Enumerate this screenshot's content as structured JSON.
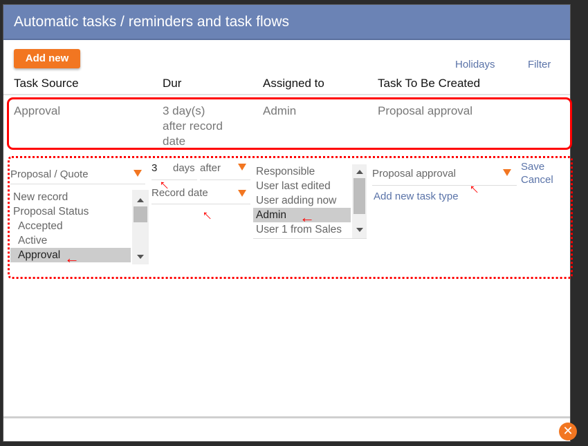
{
  "dialog": {
    "title": "Automatic tasks / reminders and task flows",
    "add_new_label": "Add new",
    "holidays_label": "Holidays",
    "filter_label": "Filter"
  },
  "table": {
    "headers": [
      "Task Source",
      "Dur",
      "Assigned to",
      "Task To Be Created"
    ],
    "rows": [
      {
        "task_source": "Approval",
        "duration_lines": [
          "3 day(s)",
          "after record",
          "date"
        ],
        "assigned_to": "Admin",
        "task_to_be_created": "Proposal approval"
      }
    ]
  },
  "editor": {
    "source_type_select": "Proposal / Quote",
    "source_list": [
      {
        "label": "New record",
        "indent": false,
        "selected": false
      },
      {
        "label": "Proposal Status",
        "indent": false,
        "selected": false
      },
      {
        "label": "Accepted",
        "indent": true,
        "selected": false
      },
      {
        "label": "Active",
        "indent": true,
        "selected": false
      },
      {
        "label": "Approval",
        "indent": true,
        "selected": true
      }
    ],
    "duration_value": "3",
    "duration_unit": "days",
    "timing_select": "after",
    "date_field_select": "Record date",
    "assignee_list": [
      {
        "label": "Responsible",
        "selected": false
      },
      {
        "label": "User last edited",
        "selected": false
      },
      {
        "label": "User adding now",
        "selected": false
      },
      {
        "label": "Admin",
        "selected": true
      },
      {
        "label": "User 1 from Sales",
        "selected": false
      }
    ],
    "task_type_select": "Proposal approval",
    "add_task_type_label": "Add new task type",
    "save_label": "Save",
    "cancel_label": "Cancel"
  },
  "footer": {
    "close_icon": "close-icon"
  },
  "colors": {
    "titlebar": "#6b83b5",
    "accent_orange": "#f27621",
    "link_blue": "#5a73a8",
    "annotation_red": "#ff0000"
  }
}
